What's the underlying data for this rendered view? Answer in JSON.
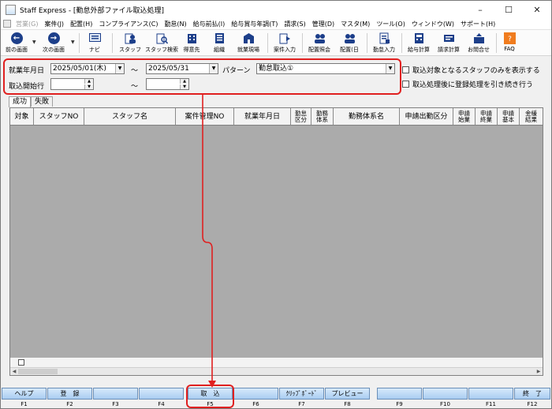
{
  "window": {
    "title": "Staff Express - [勤怠外部ファイル取込処理]"
  },
  "menu": [
    {
      "label": "営業(G)",
      "disabled": true
    },
    {
      "label": "案件(J)"
    },
    {
      "label": "配置(H)"
    },
    {
      "label": "コンプライアンス(C)"
    },
    {
      "label": "勤怠(N)"
    },
    {
      "label": "給与前払(I)"
    },
    {
      "label": "給与賞与年調(T)"
    },
    {
      "label": "請求(S)"
    },
    {
      "label": "管理(D)"
    },
    {
      "label": "マスタ(M)"
    },
    {
      "label": "ツール(O)"
    },
    {
      "label": "ウィンドウ(W)"
    },
    {
      "label": "サポート(H)"
    }
  ],
  "toolbar": {
    "prev": "前の画面",
    "next": "次の画面",
    "items": [
      "ナビ",
      "スタッフ",
      "スタッフ検索",
      "得意先",
      "組織",
      "就業現場",
      "案件入力",
      "配置照会",
      "配置(日",
      "勤怠入力",
      "給与計算",
      "請求計算",
      "お問合せ",
      "FAQ"
    ]
  },
  "filter": {
    "work_date_label": "就業年月日",
    "date_from": "2025/05/01(木)",
    "tilde": "〜",
    "date_to": "2025/05/31",
    "pattern_label": "パターン",
    "pattern_value": "勤怠取込①",
    "start_row_label": "取込開始行",
    "start_row_from": "",
    "start_row_to": ""
  },
  "options": {
    "show_target_only": "取込対象となるスタッフのみを表示する",
    "continue_register": "取込処理後に登録処理を引き続き行う"
  },
  "tabs": {
    "success": "成功",
    "failure": "失敗"
  },
  "grid": {
    "headers": [
      "対象",
      "スタッフNO",
      "スタッフ名",
      "案件管理NO",
      "就業年月日",
      "勤怠\n区分",
      "勤務\n体系",
      "勤務体系名",
      "申請出勤区分",
      "申請\n始業",
      "申請\n終業",
      "申請\n基本",
      "金緩\n結果"
    ]
  },
  "fkeys": [
    {
      "label": "ヘルプ",
      "key": "F1"
    },
    {
      "label": "登　録",
      "key": "F2"
    },
    {
      "label": "",
      "key": "F3"
    },
    {
      "label": "",
      "key": "F4"
    },
    {
      "label": "取　込",
      "key": "F5"
    },
    {
      "label": "",
      "key": "F6"
    },
    {
      "label": "ｸﾘｯﾌﾟﾎﾞｰﾄﾞ",
      "key": "F7"
    },
    {
      "label": "プレビュー",
      "key": "F8"
    },
    {
      "label": "",
      "key": "F9"
    },
    {
      "label": "",
      "key": "F10"
    },
    {
      "label": "",
      "key": "F11"
    },
    {
      "label": "終　了",
      "key": "F12"
    }
  ],
  "colors": {
    "highlight": "#e02020",
    "fkey_blue": "#a9cdf1",
    "grid_bg": "#ababab"
  }
}
